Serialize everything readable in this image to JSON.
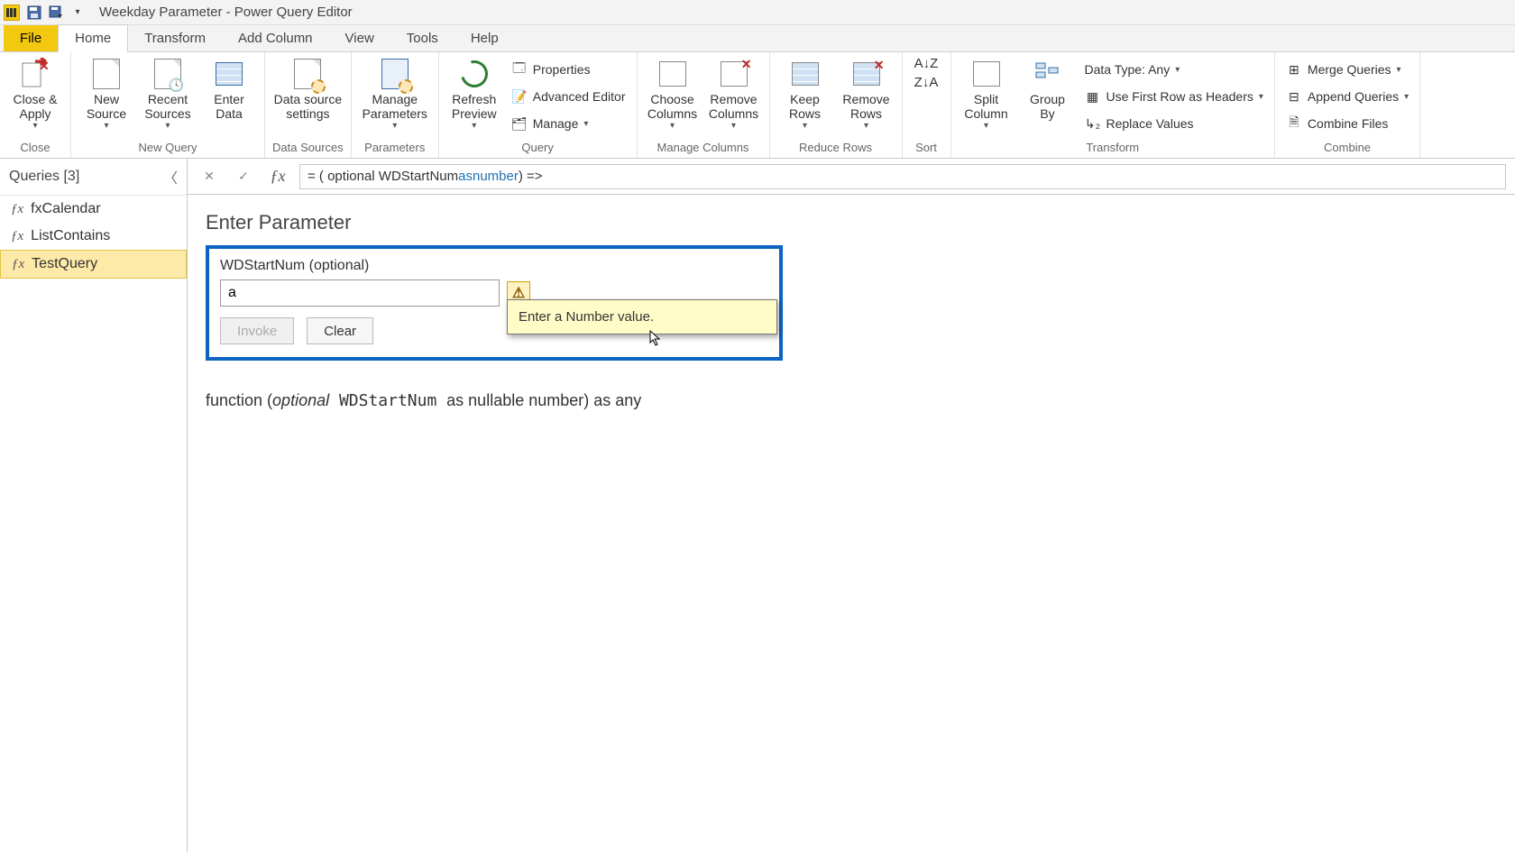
{
  "titlebar": {
    "title": "Weekday Parameter - Power Query Editor"
  },
  "ribbon_tabs": {
    "file": "File",
    "home": "Home",
    "transform": "Transform",
    "add_column": "Add Column",
    "view": "View",
    "tools": "Tools",
    "help": "Help"
  },
  "ribbon": {
    "close_group": {
      "close_apply": "Close &\nApply",
      "label": "Close"
    },
    "new_query_group": {
      "new_source": "New\nSource",
      "recent_sources": "Recent\nSources",
      "enter_data": "Enter\nData",
      "label": "New Query"
    },
    "data_sources_group": {
      "data_source_settings": "Data source\nsettings",
      "label": "Data Sources"
    },
    "parameters_group": {
      "manage_parameters": "Manage\nParameters",
      "label": "Parameters"
    },
    "query_group": {
      "refresh_preview": "Refresh\nPreview",
      "properties": "Properties",
      "advanced_editor": "Advanced Editor",
      "manage": "Manage",
      "label": "Query"
    },
    "manage_columns_group": {
      "choose_columns": "Choose\nColumns",
      "remove_columns": "Remove\nColumns",
      "label": "Manage Columns"
    },
    "reduce_rows_group": {
      "keep_rows": "Keep\nRows",
      "remove_rows": "Remove\nRows",
      "label": "Reduce Rows"
    },
    "sort_group": {
      "label": "Sort"
    },
    "transform_group": {
      "split_column": "Split\nColumn",
      "group_by": "Group\nBy",
      "data_type": "Data Type: Any",
      "first_row_headers": "Use First Row as Headers",
      "replace_values": "Replace Values",
      "label": "Transform"
    },
    "combine_group": {
      "merge_queries": "Merge Queries",
      "append_queries": "Append Queries",
      "combine_files": "Combine Files",
      "label": "Combine"
    }
  },
  "queries_pane": {
    "header": "Queries [3]",
    "items": [
      {
        "name": "fxCalendar"
      },
      {
        "name": "ListContains"
      },
      {
        "name": "TestQuery"
      }
    ]
  },
  "formula_bar": {
    "prefix": "= ( optional WDStartNum ",
    "kw_as": "as",
    "mid": " ",
    "kw_number": "number",
    "suffix": ") =>"
  },
  "enter_parameter": {
    "title": "Enter Parameter",
    "param_label": "WDStartNum (optional)",
    "input_value": "a",
    "invoke": "Invoke",
    "clear": "Clear",
    "tooltip": "Enter a Number value."
  },
  "signature": {
    "pre": "function (",
    "optional": "optional",
    "name": " WDStartNum ",
    "rest": "as nullable number) as any"
  }
}
